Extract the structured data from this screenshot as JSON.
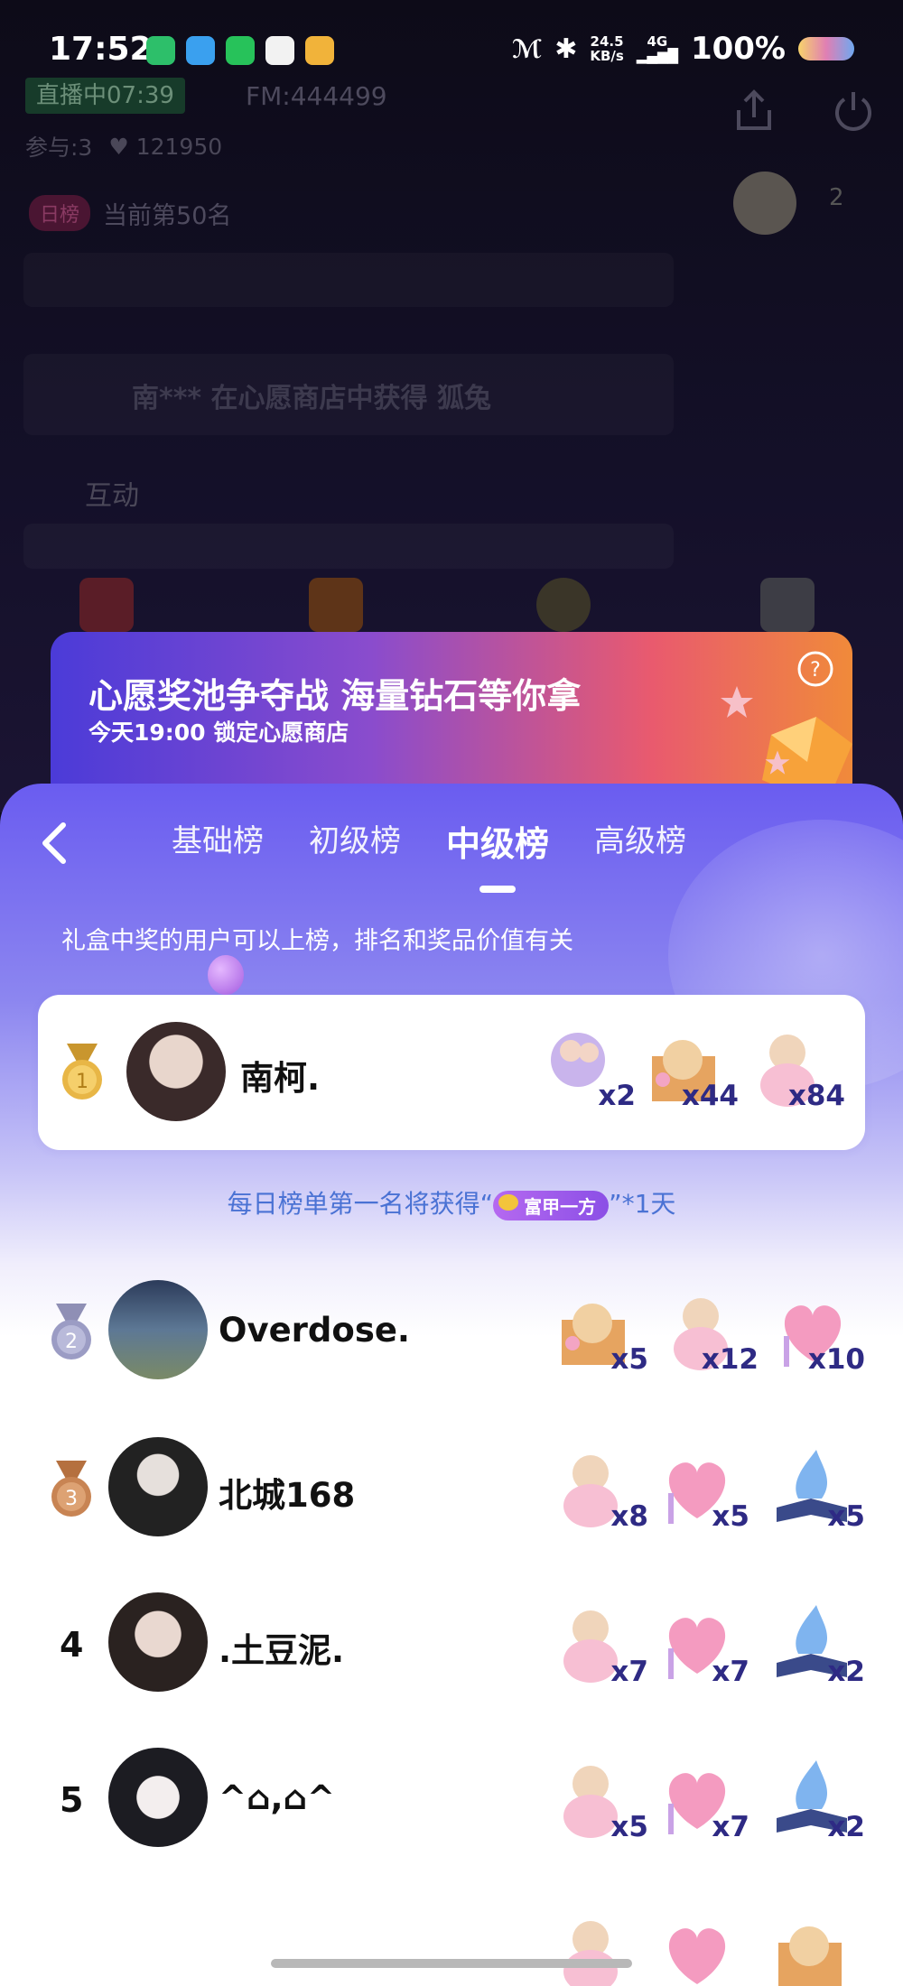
{
  "status_bar": {
    "time": "17:52",
    "net_speed": "24.5",
    "net_unit": "KB/s",
    "net_type": "4G",
    "battery": "100%"
  },
  "live": {
    "badge": "直播中07:39",
    "fm": "FM:444499",
    "participants": "参与:3",
    "likes": "121950",
    "rank_tag": "日榜",
    "rank_text": "当前第50名",
    "viewer_count": "2",
    "chat_text": "南*** 在心愿商店中获得 狐兔",
    "interact_label": "互动"
  },
  "banner": {
    "title": "心愿奖池争夺战 海量钻石等你拿",
    "subtitle": "今天19:00 锁定心愿商店",
    "colors": {
      "start": "#4b3bd8",
      "end": "#f08a3a"
    }
  },
  "leaderboard": {
    "tabs": [
      {
        "label": "基础榜"
      },
      {
        "label": "初级榜"
      },
      {
        "label": "中级榜"
      },
      {
        "label": "高级榜"
      }
    ],
    "active_tab": "中级榜",
    "description": "礼盒中奖的用户可以上榜，排名和奖品价值有关",
    "perk_prefix": "每日榜单第一名将获得“",
    "perk_badge": "富甲一方",
    "perk_suffix": "”*1天",
    "entries": [
      {
        "rank": "1",
        "name": "南柯.",
        "gifts": [
          {
            "icon": "couple-gift-icon",
            "count": "x2"
          },
          {
            "icon": "envelope-cat-gift-icon",
            "count": "x44"
          },
          {
            "icon": "bear-gift-icon",
            "count": "x84"
          }
        ]
      },
      {
        "rank": "2",
        "name": "Overdose.",
        "gifts": [
          {
            "icon": "envelope-cat-gift-icon",
            "count": "x5"
          },
          {
            "icon": "bear-gift-icon",
            "count": "x12"
          },
          {
            "icon": "heart-gift-icon",
            "count": "x10"
          }
        ]
      },
      {
        "rank": "3",
        "name": "北城168",
        "gifts": [
          {
            "icon": "bear-gift-icon",
            "count": "x8"
          },
          {
            "icon": "heart-gift-icon",
            "count": "x5"
          },
          {
            "icon": "book-gift-icon",
            "count": "x5"
          }
        ]
      },
      {
        "rank": "4",
        "name": ".土豆泥.",
        "gifts": [
          {
            "icon": "bear-gift-icon",
            "count": "x7"
          },
          {
            "icon": "heart-gift-icon",
            "count": "x7"
          },
          {
            "icon": "book-gift-icon",
            "count": "x2"
          }
        ]
      },
      {
        "rank": "5",
        "name": "^⌂,⌂^",
        "gifts": [
          {
            "icon": "bear-gift-icon",
            "count": "x5"
          },
          {
            "icon": "heart-gift-icon",
            "count": "x7"
          },
          {
            "icon": "book-gift-icon",
            "count": "x2"
          }
        ]
      }
    ]
  }
}
